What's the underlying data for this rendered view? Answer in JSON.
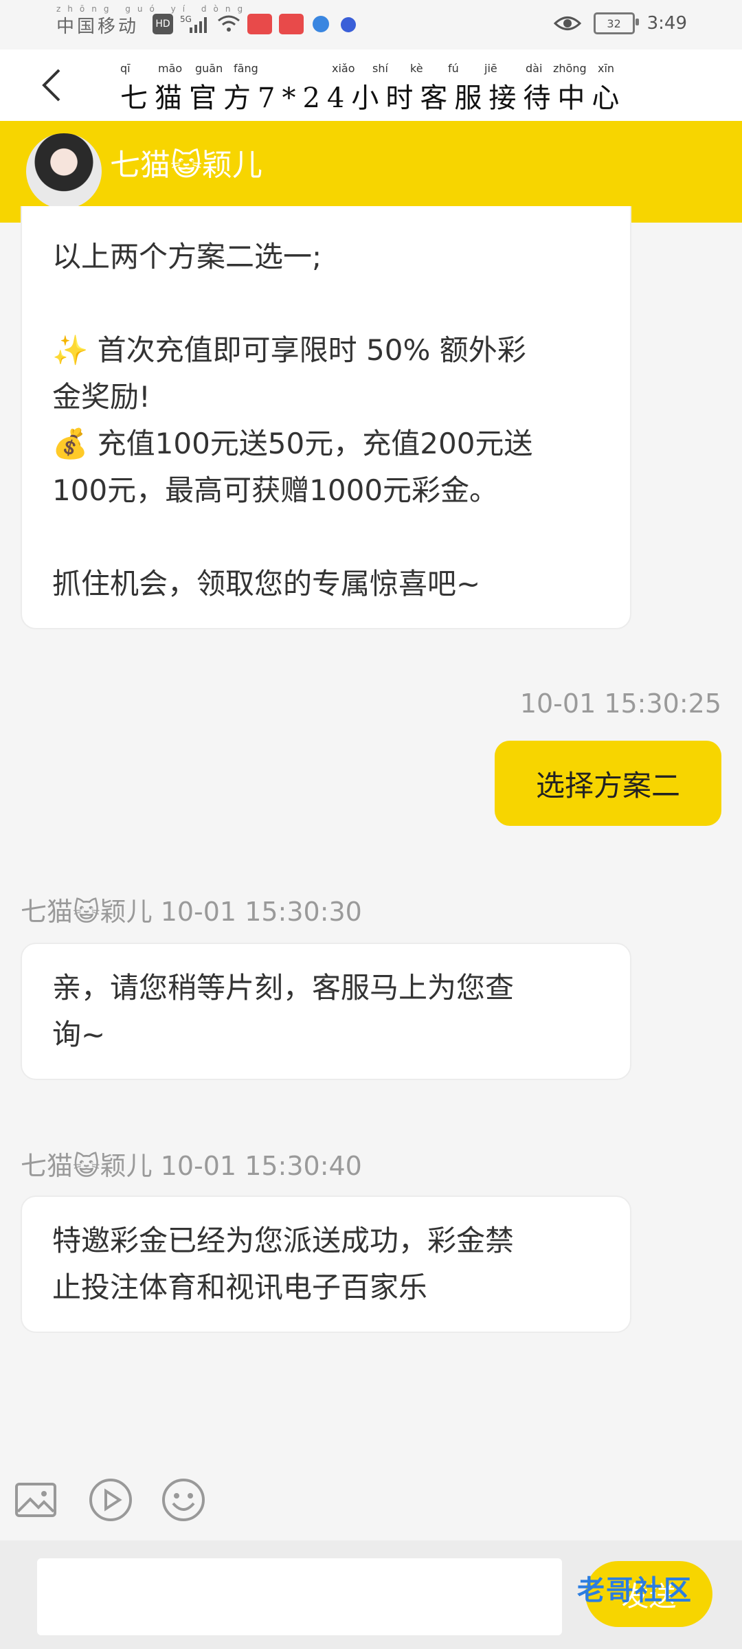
{
  "status_bar": {
    "carrier": "中国移动",
    "carrier_pinyin": "zhōng guó yí dòng",
    "badges": [
      "HD",
      "5G"
    ],
    "time": "3:49",
    "battery": "32"
  },
  "header": {
    "title": "七猫官方7*24小时客服接待中心",
    "pinyin": [
      "qī",
      "māo",
      "guān",
      "fāng",
      "xiǎo",
      "shí",
      "kè",
      "fú",
      "jiē",
      "dài",
      "zhōng",
      "xīn"
    ]
  },
  "agent": {
    "name": "七猫😺颖儿"
  },
  "messages": [
    {
      "type": "agent",
      "lines": [
        "以上两个方案二选一;",
        "",
        "✨ 首次充值即可享限时 50% 额外彩",
        "金奖励!",
        "💰 充值100元送50元，充值200元送",
        "100元，最高可获赠1000元彩金。",
        "",
        "抓住机会，领取您的专属惊喜吧~"
      ]
    },
    {
      "type": "user",
      "timestamp": "10-01 15:30:25",
      "text": "选择方案二"
    },
    {
      "type": "agent",
      "meta": "七猫😺颖儿 10-01 15:30:30",
      "lines": [
        "亲，请您稍等片刻，客服马上为您查",
        "询~"
      ]
    },
    {
      "type": "agent",
      "meta": "七猫😺颖儿 10-01 15:30:40",
      "lines": [
        "特邀彩金已经为您派送成功，彩金禁",
        "止投注体育和视讯电子百家乐"
      ]
    }
  ],
  "toolbar": {
    "icons": [
      "image-icon",
      "video-icon",
      "emoji-icon"
    ]
  },
  "composer": {
    "placeholder": "",
    "send_label": "发送"
  },
  "watermark": "老哥社区",
  "colors": {
    "accent": "#f7d500",
    "bubble": "#ffffff",
    "background": "#f5f5f5"
  }
}
